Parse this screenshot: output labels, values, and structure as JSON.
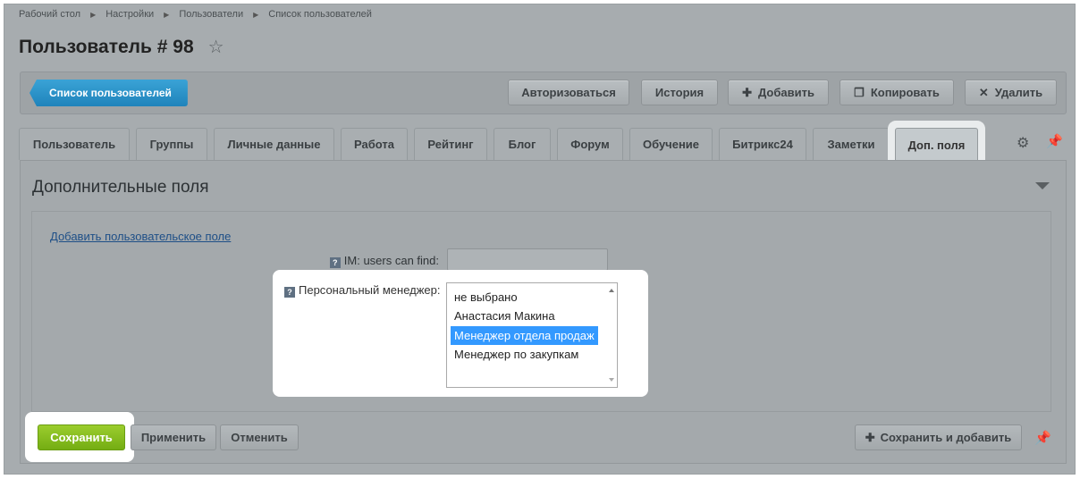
{
  "breadcrumb": [
    "Рабочий стол",
    "Настройки",
    "Пользователи",
    "Список пользователей"
  ],
  "page_title": "Пользователь # 98",
  "toolbar": {
    "list_button": "Список пользователей",
    "authorize": "Авторизоваться",
    "history": "История",
    "add": "Добавить",
    "copy": "Копировать",
    "delete": "Удалить"
  },
  "tabs": [
    "Пользователь",
    "Группы",
    "Личные данные",
    "Работа",
    "Рейтинг",
    "Блог",
    "Форум",
    "Обучение",
    "Битрикс24",
    "Заметки",
    "Доп. поля"
  ],
  "active_tab": "Доп. поля",
  "section": {
    "title": "Дополнительные поля",
    "add_field_link": "Добавить пользовательское поле",
    "help_glyph": "?",
    "im_label": "IM: users can find:",
    "im_value": "",
    "manager_label": "Персональный менеджер:",
    "manager_options": [
      "не выбрано",
      "Анастасия Макина",
      "Менеджер отдела продаж",
      "Менеджер по закупкам"
    ],
    "manager_selected": "Менеджер отдела продаж"
  },
  "footer": {
    "save": "Сохранить",
    "apply": "Применить",
    "cancel": "Отменить",
    "save_and_add": "Сохранить и добавить"
  },
  "colors": {
    "primary_blue": "#1f83bb",
    "save_green": "#74ad13",
    "selection": "#3399ff"
  }
}
